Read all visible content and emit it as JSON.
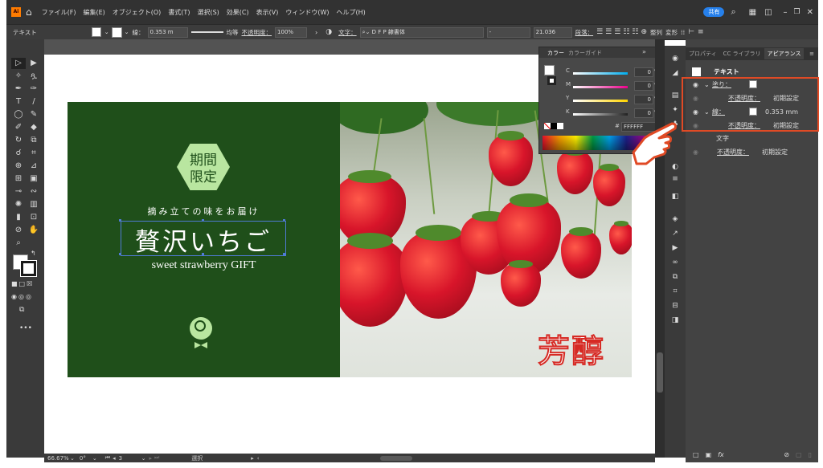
{
  "menubar": {
    "app_icon": "Ai",
    "items": [
      "ファイル(F)",
      "編集(E)",
      "オブジェクト(O)",
      "書式(T)",
      "選択(S)",
      "効果(C)",
      "表示(V)",
      "ウィンドウ(W)",
      "ヘルプ(H)"
    ],
    "share_label": "共有",
    "window_controls": [
      "minimize-icon",
      "restore-icon",
      "close-icon"
    ]
  },
  "control_bar": {
    "object_type": "テキスト",
    "stroke_label": "線：",
    "stroke_weight": "0.353 m",
    "stroke_profile": "均等",
    "opacity_label": "不透明度：",
    "opacity_value": "100%",
    "char_label": "文字：",
    "font_family": "D F P 隷書体",
    "font_style": "-",
    "font_size": "21.036",
    "para_label": "段落：",
    "align_label": "整列",
    "transform_label": "変形"
  },
  "color_panel": {
    "tabs": [
      "カラー",
      "カラーガイド"
    ],
    "channels": [
      {
        "label": "C",
        "value": "0",
        "unit": "%",
        "color": "#00aeef"
      },
      {
        "label": "M",
        "value": "0",
        "unit": "%",
        "color": "#ec008c"
      },
      {
        "label": "Y",
        "value": "0",
        "unit": "%",
        "color": "#ffd400"
      },
      {
        "label": "K",
        "value": "0",
        "unit": "%",
        "color": "#222222"
      }
    ],
    "hex_prefix": "#",
    "hex_value": "FFFFFF"
  },
  "right_panel": {
    "tabs": [
      "プロパティ",
      "CC ライブラリ",
      "アピアランス"
    ],
    "active_tab": "アピアランス",
    "header": "テキスト",
    "rows": {
      "fill_label": "塗り：",
      "fill_opacity_label": "不透明度：",
      "fill_opacity_value": "初期設定",
      "stroke_label": "線：",
      "stroke_value": "0.353 mm",
      "stroke_opacity_label": "不透明度：",
      "stroke_opacity_value": "初期設定",
      "char_label": "文字",
      "opacity_label": "不透明度：",
      "opacity_value": "初期設定"
    }
  },
  "artwork": {
    "badge_line1": "期間",
    "badge_line2": "限定",
    "tagline": "摘み立ての味をお届け",
    "title": "贅沢いちご",
    "subtitle": "sweet strawberry GIFT",
    "photo_text": "芳醇",
    "colors": {
      "green": "#1f4f1a",
      "badge": "#b9e6a0",
      "accent": "#e04a25"
    }
  },
  "status_bar": {
    "zoom": "66.67%",
    "rotation": "0°",
    "page": "3",
    "mode": "選択"
  }
}
